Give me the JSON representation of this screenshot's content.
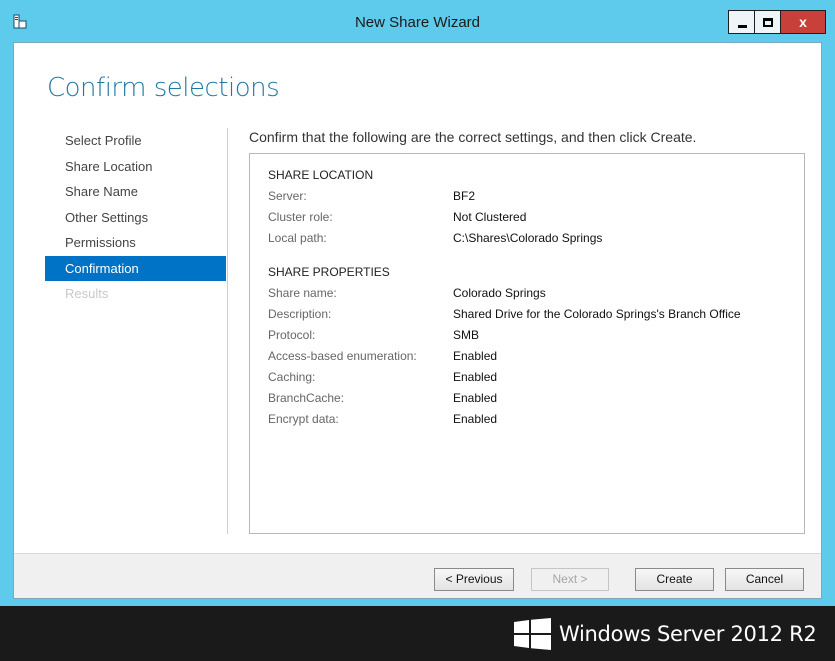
{
  "window": {
    "title": "New Share Wizard",
    "close_glyph": "x"
  },
  "page": {
    "heading": "Confirm selections",
    "instruction": "Confirm that the following are the correct settings, and then click Create."
  },
  "nav": {
    "items": [
      {
        "label": "Select Profile",
        "state": "normal"
      },
      {
        "label": "Share Location",
        "state": "normal"
      },
      {
        "label": "Share Name",
        "state": "normal"
      },
      {
        "label": "Other Settings",
        "state": "normal"
      },
      {
        "label": "Permissions",
        "state": "normal"
      },
      {
        "label": "Confirmation",
        "state": "active"
      },
      {
        "label": "Results",
        "state": "disabled"
      }
    ]
  },
  "summary": {
    "location": {
      "title": "SHARE LOCATION",
      "rows": [
        {
          "label": "Server:",
          "value": "BF2"
        },
        {
          "label": "Cluster role:",
          "value": "Not Clustered"
        },
        {
          "label": "Local path:",
          "value": "C:\\Shares\\Colorado Springs"
        }
      ]
    },
    "properties": {
      "title": "SHARE PROPERTIES",
      "rows": [
        {
          "label": "Share name:",
          "value": "Colorado Springs"
        },
        {
          "label": "Description:",
          "value": "Shared Drive for the Colorado Springs's Branch Office"
        },
        {
          "label": "Protocol:",
          "value": "SMB"
        },
        {
          "label": "Access-based enumeration:",
          "value": "Enabled"
        },
        {
          "label": "Caching:",
          "value": "Enabled"
        },
        {
          "label": "BranchCache:",
          "value": "Enabled"
        },
        {
          "label": "Encrypt data:",
          "value": "Enabled"
        }
      ]
    }
  },
  "buttons": {
    "previous": "< Previous",
    "next": "Next >",
    "create": "Create",
    "cancel": "Cancel"
  },
  "branding": {
    "text": "Windows Server 2012 R2"
  },
  "colors": {
    "title_bar": "#5ecbed",
    "heading": "#1e7aa5",
    "nav_active": "#0073c6",
    "close_button": "#c7403a"
  },
  "icons": {
    "app": "server-manager-icon",
    "minimize": "minimize-icon",
    "maximize": "maximize-icon",
    "close": "close-icon",
    "logo": "windows-logo-icon"
  }
}
